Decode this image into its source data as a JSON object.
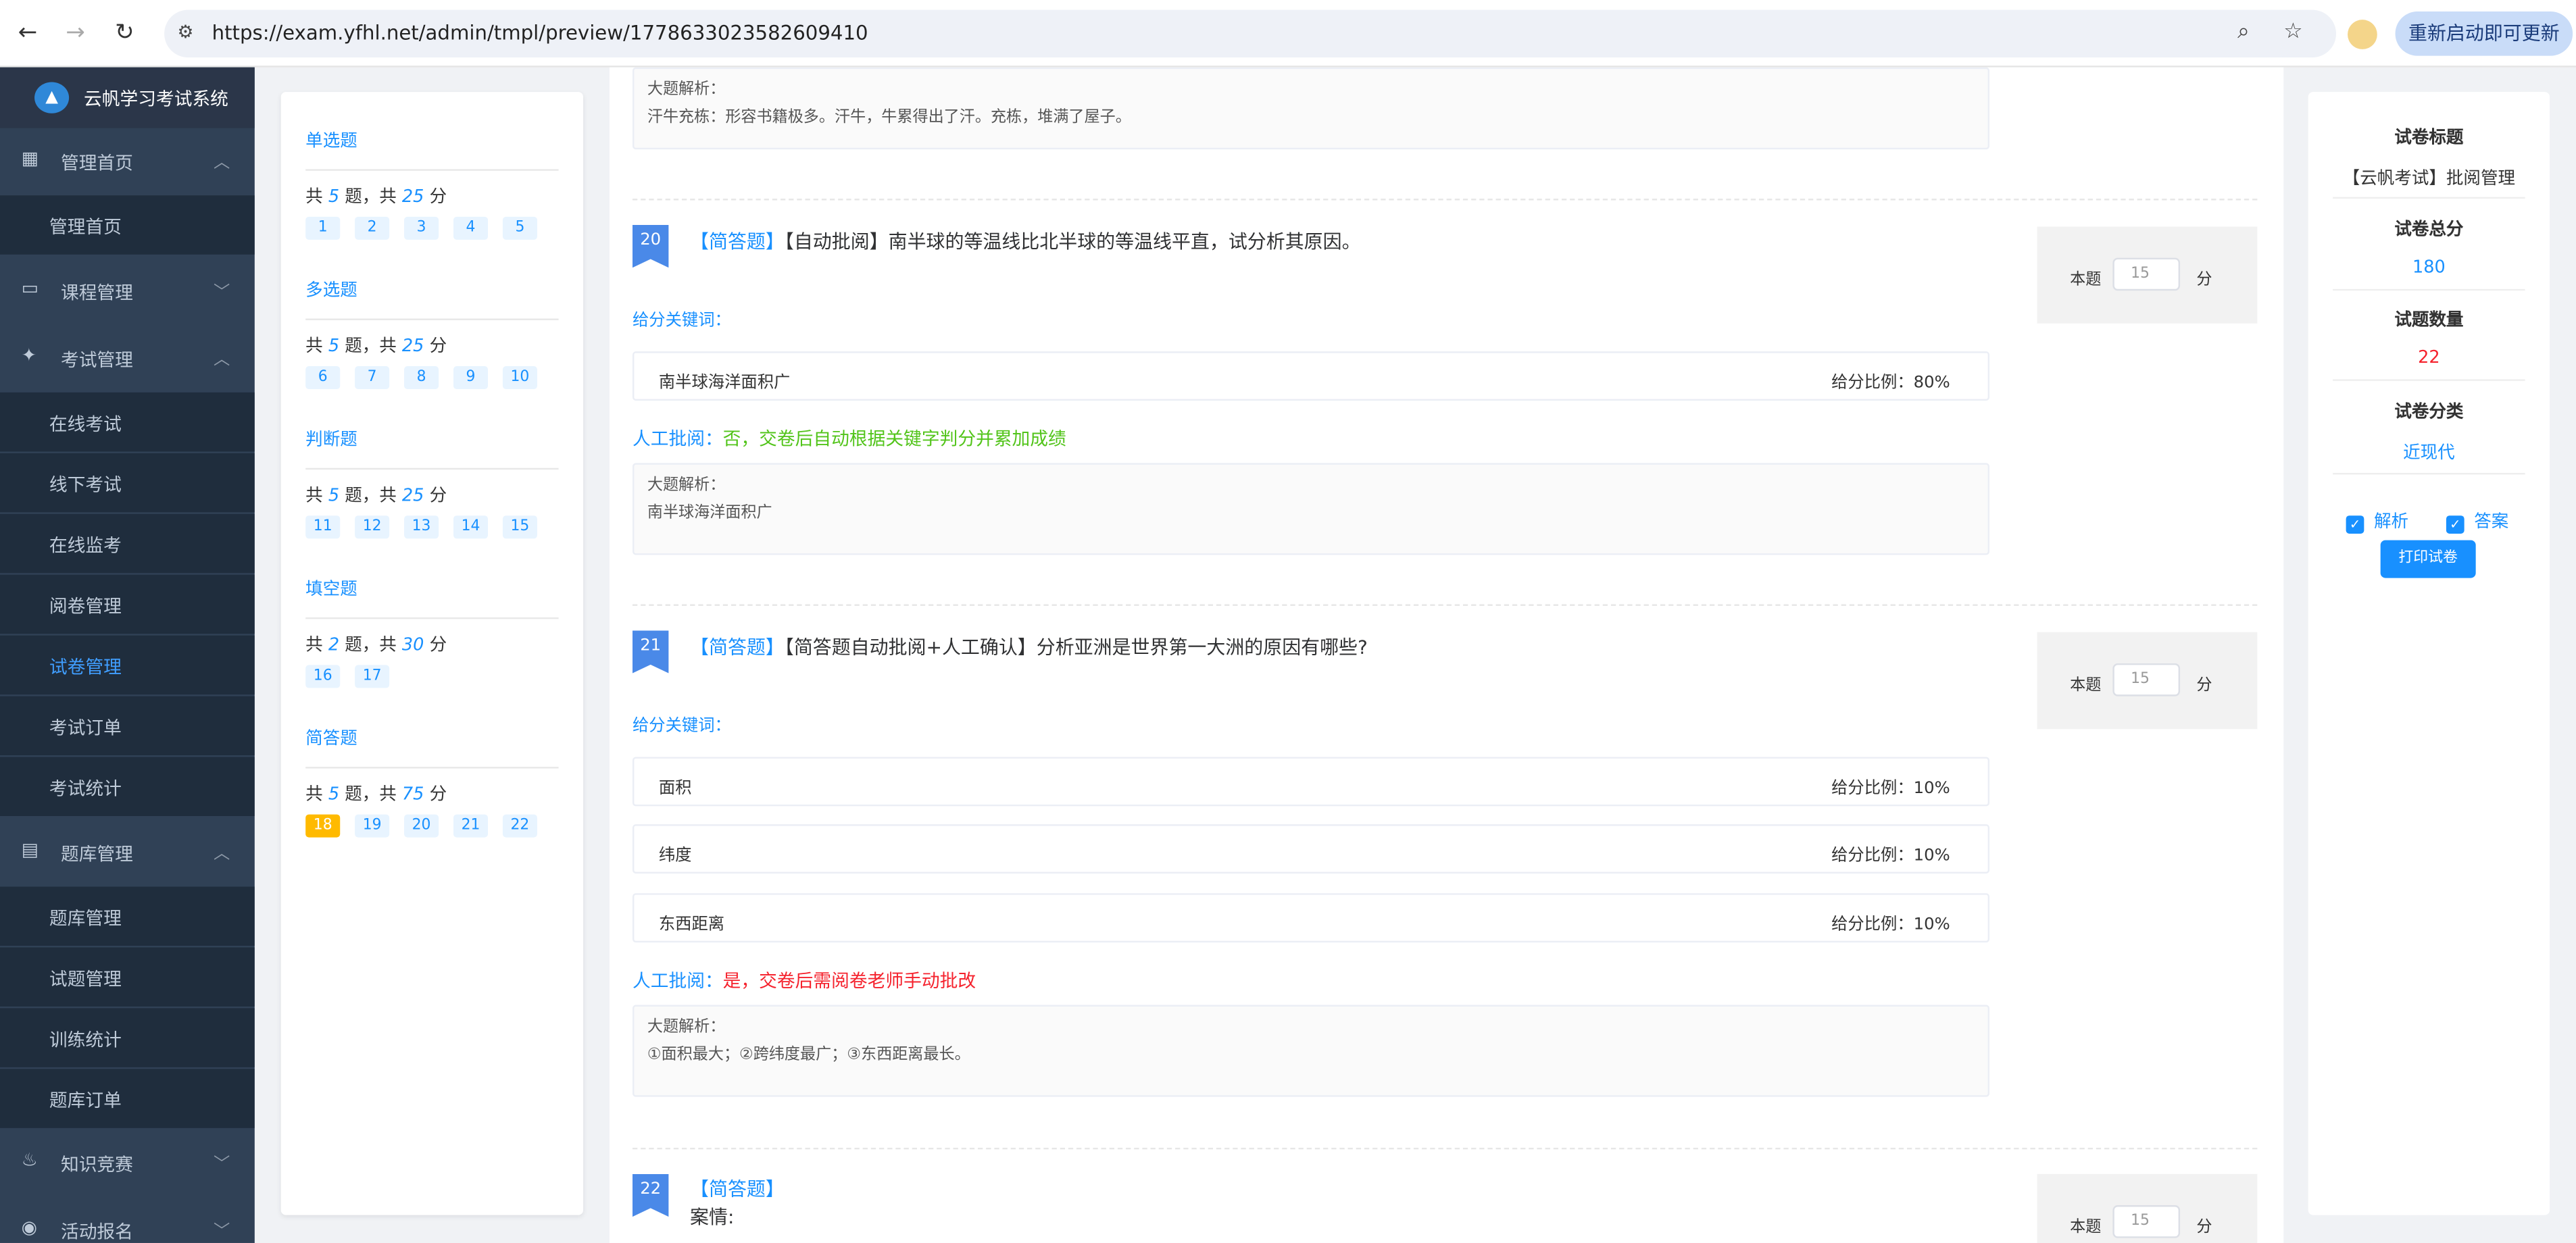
{
  "browser": {
    "url": "https://exam.yfhl.net/admin/tmpl/preview/1778633023582609410",
    "relaunch_label": "重新启动即可更新",
    "back_icon": "←",
    "forward_icon": "→",
    "reload_icon": "↻",
    "tune_icon": "⚙",
    "zoom_icon": "⌕",
    "star_icon": "☆"
  },
  "sidebar": {
    "brand": "云帆学习考试系统",
    "groups": [
      {
        "label": "管理首页",
        "icon": "▦",
        "chev": "︿"
      },
      {
        "label": "课程管理",
        "icon": "▭",
        "chev": "﹀"
      },
      {
        "label": "考试管理",
        "icon": "✦",
        "chev": "︿"
      },
      {
        "label": "题库管理",
        "icon": "▤",
        "chev": "︿"
      },
      {
        "label": "知识竞赛",
        "icon": "♨",
        "chev": "﹀"
      },
      {
        "label": "活动报名",
        "icon": "◉",
        "chev": "﹀"
      }
    ],
    "items": [
      "管理首页",
      "在线考试",
      "线下考试",
      "在线监考",
      "阅卷管理",
      "试卷管理",
      "考试订单",
      "考试统计",
      "题库管理",
      "试题管理",
      "训练统计",
      "题库订单"
    ]
  },
  "qpanel": {
    "sections": [
      {
        "title": "单选题",
        "count": "5",
        "score": "25",
        "nums": [
          "1",
          "2",
          "3",
          "4",
          "5"
        ]
      },
      {
        "title": "多选题",
        "count": "5",
        "score": "25",
        "nums": [
          "6",
          "7",
          "8",
          "9",
          "10"
        ]
      },
      {
        "title": "判断题",
        "count": "5",
        "score": "25",
        "nums": [
          "11",
          "12",
          "13",
          "14",
          "15"
        ]
      },
      {
        "title": "填空题",
        "count": "2",
        "score": "30",
        "nums": [
          "16",
          "17"
        ]
      },
      {
        "title": "简答题",
        "count": "5",
        "score": "75",
        "nums": [
          "18",
          "19",
          "20",
          "21",
          "22"
        ]
      }
    ],
    "t1": "共",
    "t2": "题，共",
    "t3": "分"
  },
  "main": {
    "labels": {
      "analysis": "大题解析：",
      "keywords": "给分关键词：",
      "ratio": "给分比例：",
      "manual": "人工批阅：",
      "score_prefix": "本题",
      "score_suffix": "分",
      "tag": "【简答题】"
    },
    "top_analysis": "汗牛充栋：形容书籍极多。汗牛，牛累得出了汗。充栋，堆满了屋子。",
    "q20": {
      "no": "20",
      "text": "【自动批阅】南半球的等温线比北半球的等温线平直，试分析其原因。",
      "score": "15",
      "keywords": [
        {
          "k": "南半球海洋面积广",
          "r": "80%"
        }
      ],
      "manual": "否，交卷后自动根据关键字判分并累加成绩",
      "analysis": "南半球海洋面积广"
    },
    "q21": {
      "no": "21",
      "text": "【简答题自动批阅+人工确认】分析亚洲是世界第一大洲的原因有哪些?",
      "score": "15",
      "keywords": [
        {
          "k": "面积",
          "r": "10%"
        },
        {
          "k": "纬度",
          "r": "10%"
        },
        {
          "k": "东西距离",
          "r": "10%"
        }
      ],
      "manual": "是，交卷后需阅卷老师手动批改",
      "analysis": "①面积最大；②跨纬度最广；③东西距离最长。"
    },
    "q22": {
      "no": "22",
      "text": "案情:",
      "score": "15"
    }
  },
  "right": {
    "title_label": "试卷标题",
    "title": "【云帆考试】批阅管理",
    "total_label": "试卷总分",
    "total": "180",
    "count_label": "试题数量",
    "count": "22",
    "cat_label": "试卷分类",
    "cat": "近现代",
    "cb1": "解析",
    "cb2": "答案",
    "check": "✓",
    "print": "打印试卷"
  }
}
